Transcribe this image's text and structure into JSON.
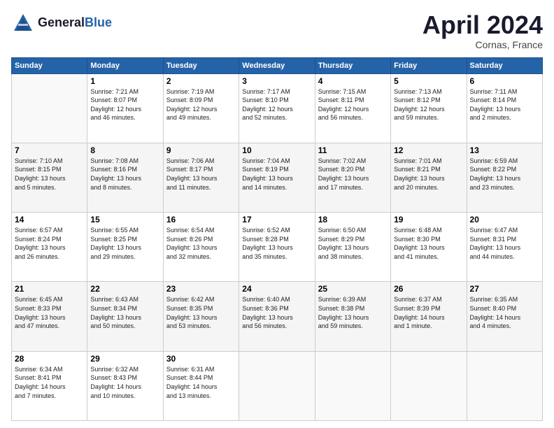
{
  "header": {
    "logo_line1": "General",
    "logo_line2": "Blue",
    "month": "April 2024",
    "location": "Cornas, France"
  },
  "weekdays": [
    "Sunday",
    "Monday",
    "Tuesday",
    "Wednesday",
    "Thursday",
    "Friday",
    "Saturday"
  ],
  "weeks": [
    [
      {
        "day": "",
        "info": ""
      },
      {
        "day": "1",
        "info": "Sunrise: 7:21 AM\nSunset: 8:07 PM\nDaylight: 12 hours\nand 46 minutes."
      },
      {
        "day": "2",
        "info": "Sunrise: 7:19 AM\nSunset: 8:09 PM\nDaylight: 12 hours\nand 49 minutes."
      },
      {
        "day": "3",
        "info": "Sunrise: 7:17 AM\nSunset: 8:10 PM\nDaylight: 12 hours\nand 52 minutes."
      },
      {
        "day": "4",
        "info": "Sunrise: 7:15 AM\nSunset: 8:11 PM\nDaylight: 12 hours\nand 56 minutes."
      },
      {
        "day": "5",
        "info": "Sunrise: 7:13 AM\nSunset: 8:12 PM\nDaylight: 12 hours\nand 59 minutes."
      },
      {
        "day": "6",
        "info": "Sunrise: 7:11 AM\nSunset: 8:14 PM\nDaylight: 13 hours\nand 2 minutes."
      }
    ],
    [
      {
        "day": "7",
        "info": "Sunrise: 7:10 AM\nSunset: 8:15 PM\nDaylight: 13 hours\nand 5 minutes."
      },
      {
        "day": "8",
        "info": "Sunrise: 7:08 AM\nSunset: 8:16 PM\nDaylight: 13 hours\nand 8 minutes."
      },
      {
        "day": "9",
        "info": "Sunrise: 7:06 AM\nSunset: 8:17 PM\nDaylight: 13 hours\nand 11 minutes."
      },
      {
        "day": "10",
        "info": "Sunrise: 7:04 AM\nSunset: 8:19 PM\nDaylight: 13 hours\nand 14 minutes."
      },
      {
        "day": "11",
        "info": "Sunrise: 7:02 AM\nSunset: 8:20 PM\nDaylight: 13 hours\nand 17 minutes."
      },
      {
        "day": "12",
        "info": "Sunrise: 7:01 AM\nSunset: 8:21 PM\nDaylight: 13 hours\nand 20 minutes."
      },
      {
        "day": "13",
        "info": "Sunrise: 6:59 AM\nSunset: 8:22 PM\nDaylight: 13 hours\nand 23 minutes."
      }
    ],
    [
      {
        "day": "14",
        "info": "Sunrise: 6:57 AM\nSunset: 8:24 PM\nDaylight: 13 hours\nand 26 minutes."
      },
      {
        "day": "15",
        "info": "Sunrise: 6:55 AM\nSunset: 8:25 PM\nDaylight: 13 hours\nand 29 minutes."
      },
      {
        "day": "16",
        "info": "Sunrise: 6:54 AM\nSunset: 8:26 PM\nDaylight: 13 hours\nand 32 minutes."
      },
      {
        "day": "17",
        "info": "Sunrise: 6:52 AM\nSunset: 8:28 PM\nDaylight: 13 hours\nand 35 minutes."
      },
      {
        "day": "18",
        "info": "Sunrise: 6:50 AM\nSunset: 8:29 PM\nDaylight: 13 hours\nand 38 minutes."
      },
      {
        "day": "19",
        "info": "Sunrise: 6:48 AM\nSunset: 8:30 PM\nDaylight: 13 hours\nand 41 minutes."
      },
      {
        "day": "20",
        "info": "Sunrise: 6:47 AM\nSunset: 8:31 PM\nDaylight: 13 hours\nand 44 minutes."
      }
    ],
    [
      {
        "day": "21",
        "info": "Sunrise: 6:45 AM\nSunset: 8:33 PM\nDaylight: 13 hours\nand 47 minutes."
      },
      {
        "day": "22",
        "info": "Sunrise: 6:43 AM\nSunset: 8:34 PM\nDaylight: 13 hours\nand 50 minutes."
      },
      {
        "day": "23",
        "info": "Sunrise: 6:42 AM\nSunset: 8:35 PM\nDaylight: 13 hours\nand 53 minutes."
      },
      {
        "day": "24",
        "info": "Sunrise: 6:40 AM\nSunset: 8:36 PM\nDaylight: 13 hours\nand 56 minutes."
      },
      {
        "day": "25",
        "info": "Sunrise: 6:39 AM\nSunset: 8:38 PM\nDaylight: 13 hours\nand 59 minutes."
      },
      {
        "day": "26",
        "info": "Sunrise: 6:37 AM\nSunset: 8:39 PM\nDaylight: 14 hours\nand 1 minute."
      },
      {
        "day": "27",
        "info": "Sunrise: 6:35 AM\nSunset: 8:40 PM\nDaylight: 14 hours\nand 4 minutes."
      }
    ],
    [
      {
        "day": "28",
        "info": "Sunrise: 6:34 AM\nSunset: 8:41 PM\nDaylight: 14 hours\nand 7 minutes."
      },
      {
        "day": "29",
        "info": "Sunrise: 6:32 AM\nSunset: 8:43 PM\nDaylight: 14 hours\nand 10 minutes."
      },
      {
        "day": "30",
        "info": "Sunrise: 6:31 AM\nSunset: 8:44 PM\nDaylight: 14 hours\nand 13 minutes."
      },
      {
        "day": "",
        "info": ""
      },
      {
        "day": "",
        "info": ""
      },
      {
        "day": "",
        "info": ""
      },
      {
        "day": "",
        "info": ""
      }
    ]
  ]
}
